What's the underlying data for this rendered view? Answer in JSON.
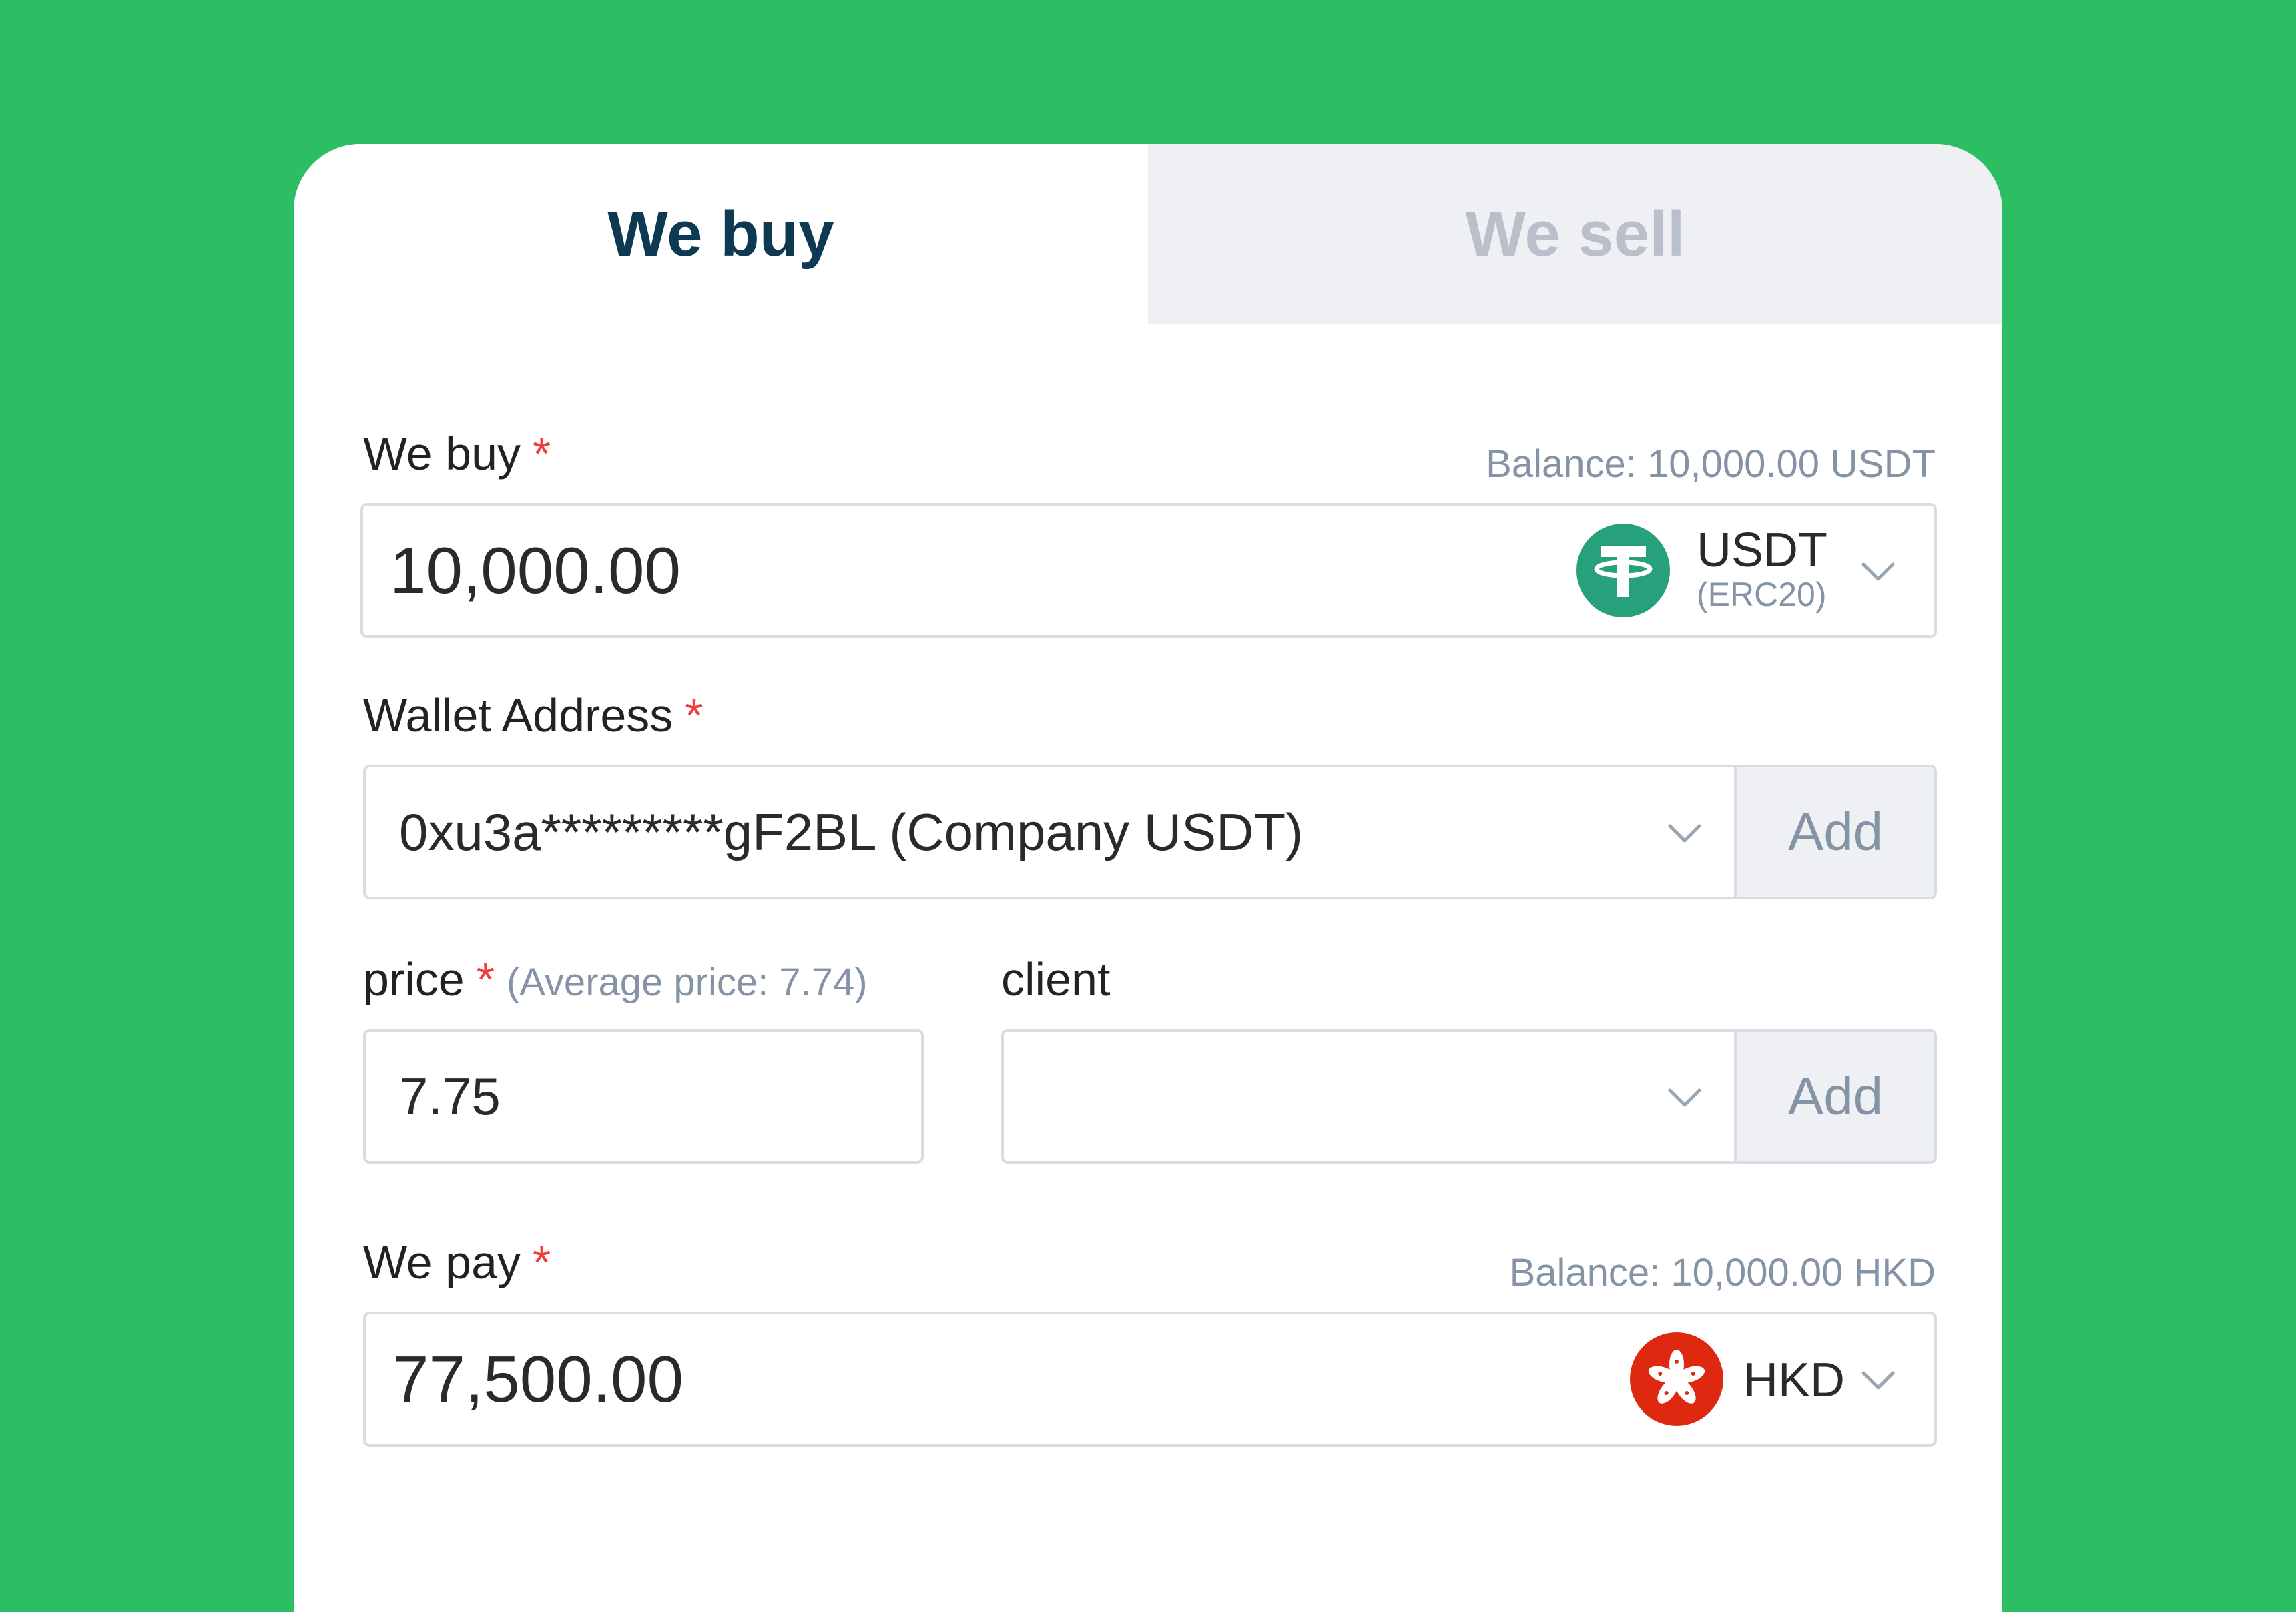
{
  "tabs": {
    "buy_label": "We buy",
    "sell_label": "We sell"
  },
  "buy_section": {
    "label": "We buy",
    "required_mark": "*",
    "balance_text": "Balance: 10,000.00 USDT",
    "amount": "10,000.00",
    "currency": "USDT",
    "currency_network": "(ERC20)",
    "currency_icon": "tether-icon"
  },
  "wallet_section": {
    "label": "Wallet Address",
    "required_mark": "*",
    "selected_value": "0xu3a*********gF2BL (Company USDT)",
    "add_label": "Add"
  },
  "price_section": {
    "label": "price",
    "required_mark": "*",
    "hint": "(Average price: 7.74)",
    "value": "7.75"
  },
  "client_section": {
    "label": "client",
    "selected_value": "",
    "add_label": "Add"
  },
  "pay_section": {
    "label": "We pay",
    "required_mark": "*",
    "balance_text": "Balance: 10,000.00 HKD",
    "amount": "77,500.00",
    "currency": "HKD",
    "currency_icon": "hong-kong-flag-icon"
  },
  "colors": {
    "background": "#2dbd63",
    "tab_active_text": "#0d3a52",
    "tab_inactive_text": "#b9c0ca",
    "tab_inactive_bg": "#eef0f4",
    "required": "#f03d3d",
    "muted_text": "#8593a6",
    "tether": "#26a17b",
    "hkd_flag": "#de2910"
  }
}
